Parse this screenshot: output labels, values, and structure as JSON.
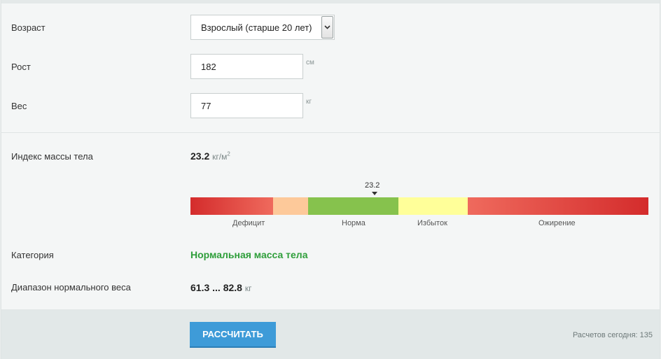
{
  "form": {
    "age": {
      "label": "Возраст",
      "selected": "Взрослый (старше 20 лет)"
    },
    "height": {
      "label": "Рост",
      "value": "182",
      "unit": "см"
    },
    "weight": {
      "label": "Вес",
      "value": "77",
      "unit": "кг"
    }
  },
  "result": {
    "bmi_label": "Индекс массы тела",
    "bmi_value": "23.2",
    "bmi_unit": "кг/м",
    "bmi_unit_sup": "2",
    "marker_value": "23.2",
    "scale": {
      "labels": [
        "Дефицит",
        "Норма",
        "Избыток",
        "Ожирение"
      ],
      "colors": {
        "deficit": "#d42c2c",
        "light": "#fdc99a",
        "norm": "#86c24d",
        "over": "#ffff99",
        "obese": "#d42c2c"
      }
    },
    "category_label": "Категория",
    "category_value": "Нормальная масса тела",
    "category_color": "#2e9e3a",
    "range_label": "Диапазон нормального веса",
    "range_min": "61.3",
    "range_sep": " ... ",
    "range_max": "82.8",
    "range_unit": "кг"
  },
  "footer": {
    "button_label": "РАССЧИТАТЬ",
    "counter_text": "Расчетов сегодня: 135",
    "button_color": "#3e9bd8"
  }
}
